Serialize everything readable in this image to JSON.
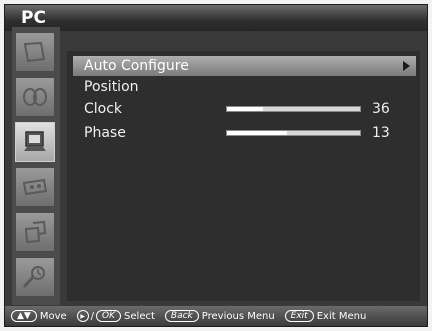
{
  "window": {
    "title": "PC"
  },
  "menu": {
    "items": [
      {
        "label": "Auto Configure",
        "selected": true,
        "has_submenu": true
      },
      {
        "label": "Position"
      },
      {
        "label": "Clock",
        "value": "36",
        "fill": 0.27
      },
      {
        "label": "Phase",
        "value": "13",
        "fill": 0.45
      }
    ]
  },
  "footer": {
    "move_label": "Move",
    "select_key": "OK",
    "select_label": "Select",
    "back_key": "Back",
    "back_label": "Previous Menu",
    "exit_key": "Exit",
    "exit_label": "Exit Menu"
  },
  "sidebar": {
    "icons": [
      "picture-icon",
      "sound-icon",
      "pc-monitor-icon",
      "tape-icon",
      "pip-icon",
      "setup-icon"
    ],
    "active_index": 2
  }
}
